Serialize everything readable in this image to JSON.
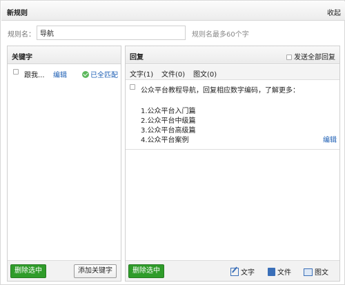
{
  "header": {
    "title": "新规则",
    "collapse_label": "收起"
  },
  "rule_name": {
    "label": "规则名：",
    "value": "导航",
    "hint": "规则名最多60个字"
  },
  "keywords_panel": {
    "title": "关键字",
    "items": [
      {
        "text": "跟我...",
        "edit_label": "编辑",
        "match_label": "已全匹配"
      }
    ],
    "delete_label": "删除选中",
    "add_label": "添加关键字"
  },
  "reply_panel": {
    "title": "回复",
    "send_all_label": "发送全部回复",
    "tabs": [
      "文字(1)",
      "文件(0)",
      "图文(0)"
    ],
    "item": {
      "lines": [
        "公众平台教程导航，回复相应数字编码，了解更多：",
        "",
        "1.公众平台入门篇",
        "2.公众平台中级篇",
        "3.公众平台高级篇",
        "4.公众平台案例"
      ],
      "edit_label": "编辑"
    },
    "delete_label": "删除选中",
    "footer": {
      "text_label": "文字",
      "file_label": "文件",
      "image_text_label": "图文"
    }
  },
  "icons": {
    "check": "check-circle-icon",
    "edit": "edit-icon",
    "file": "file-icon",
    "image_text": "image-icon"
  },
  "colors": {
    "accent_green": "#2f9c2a",
    "link_blue": "#1e5fb4"
  }
}
